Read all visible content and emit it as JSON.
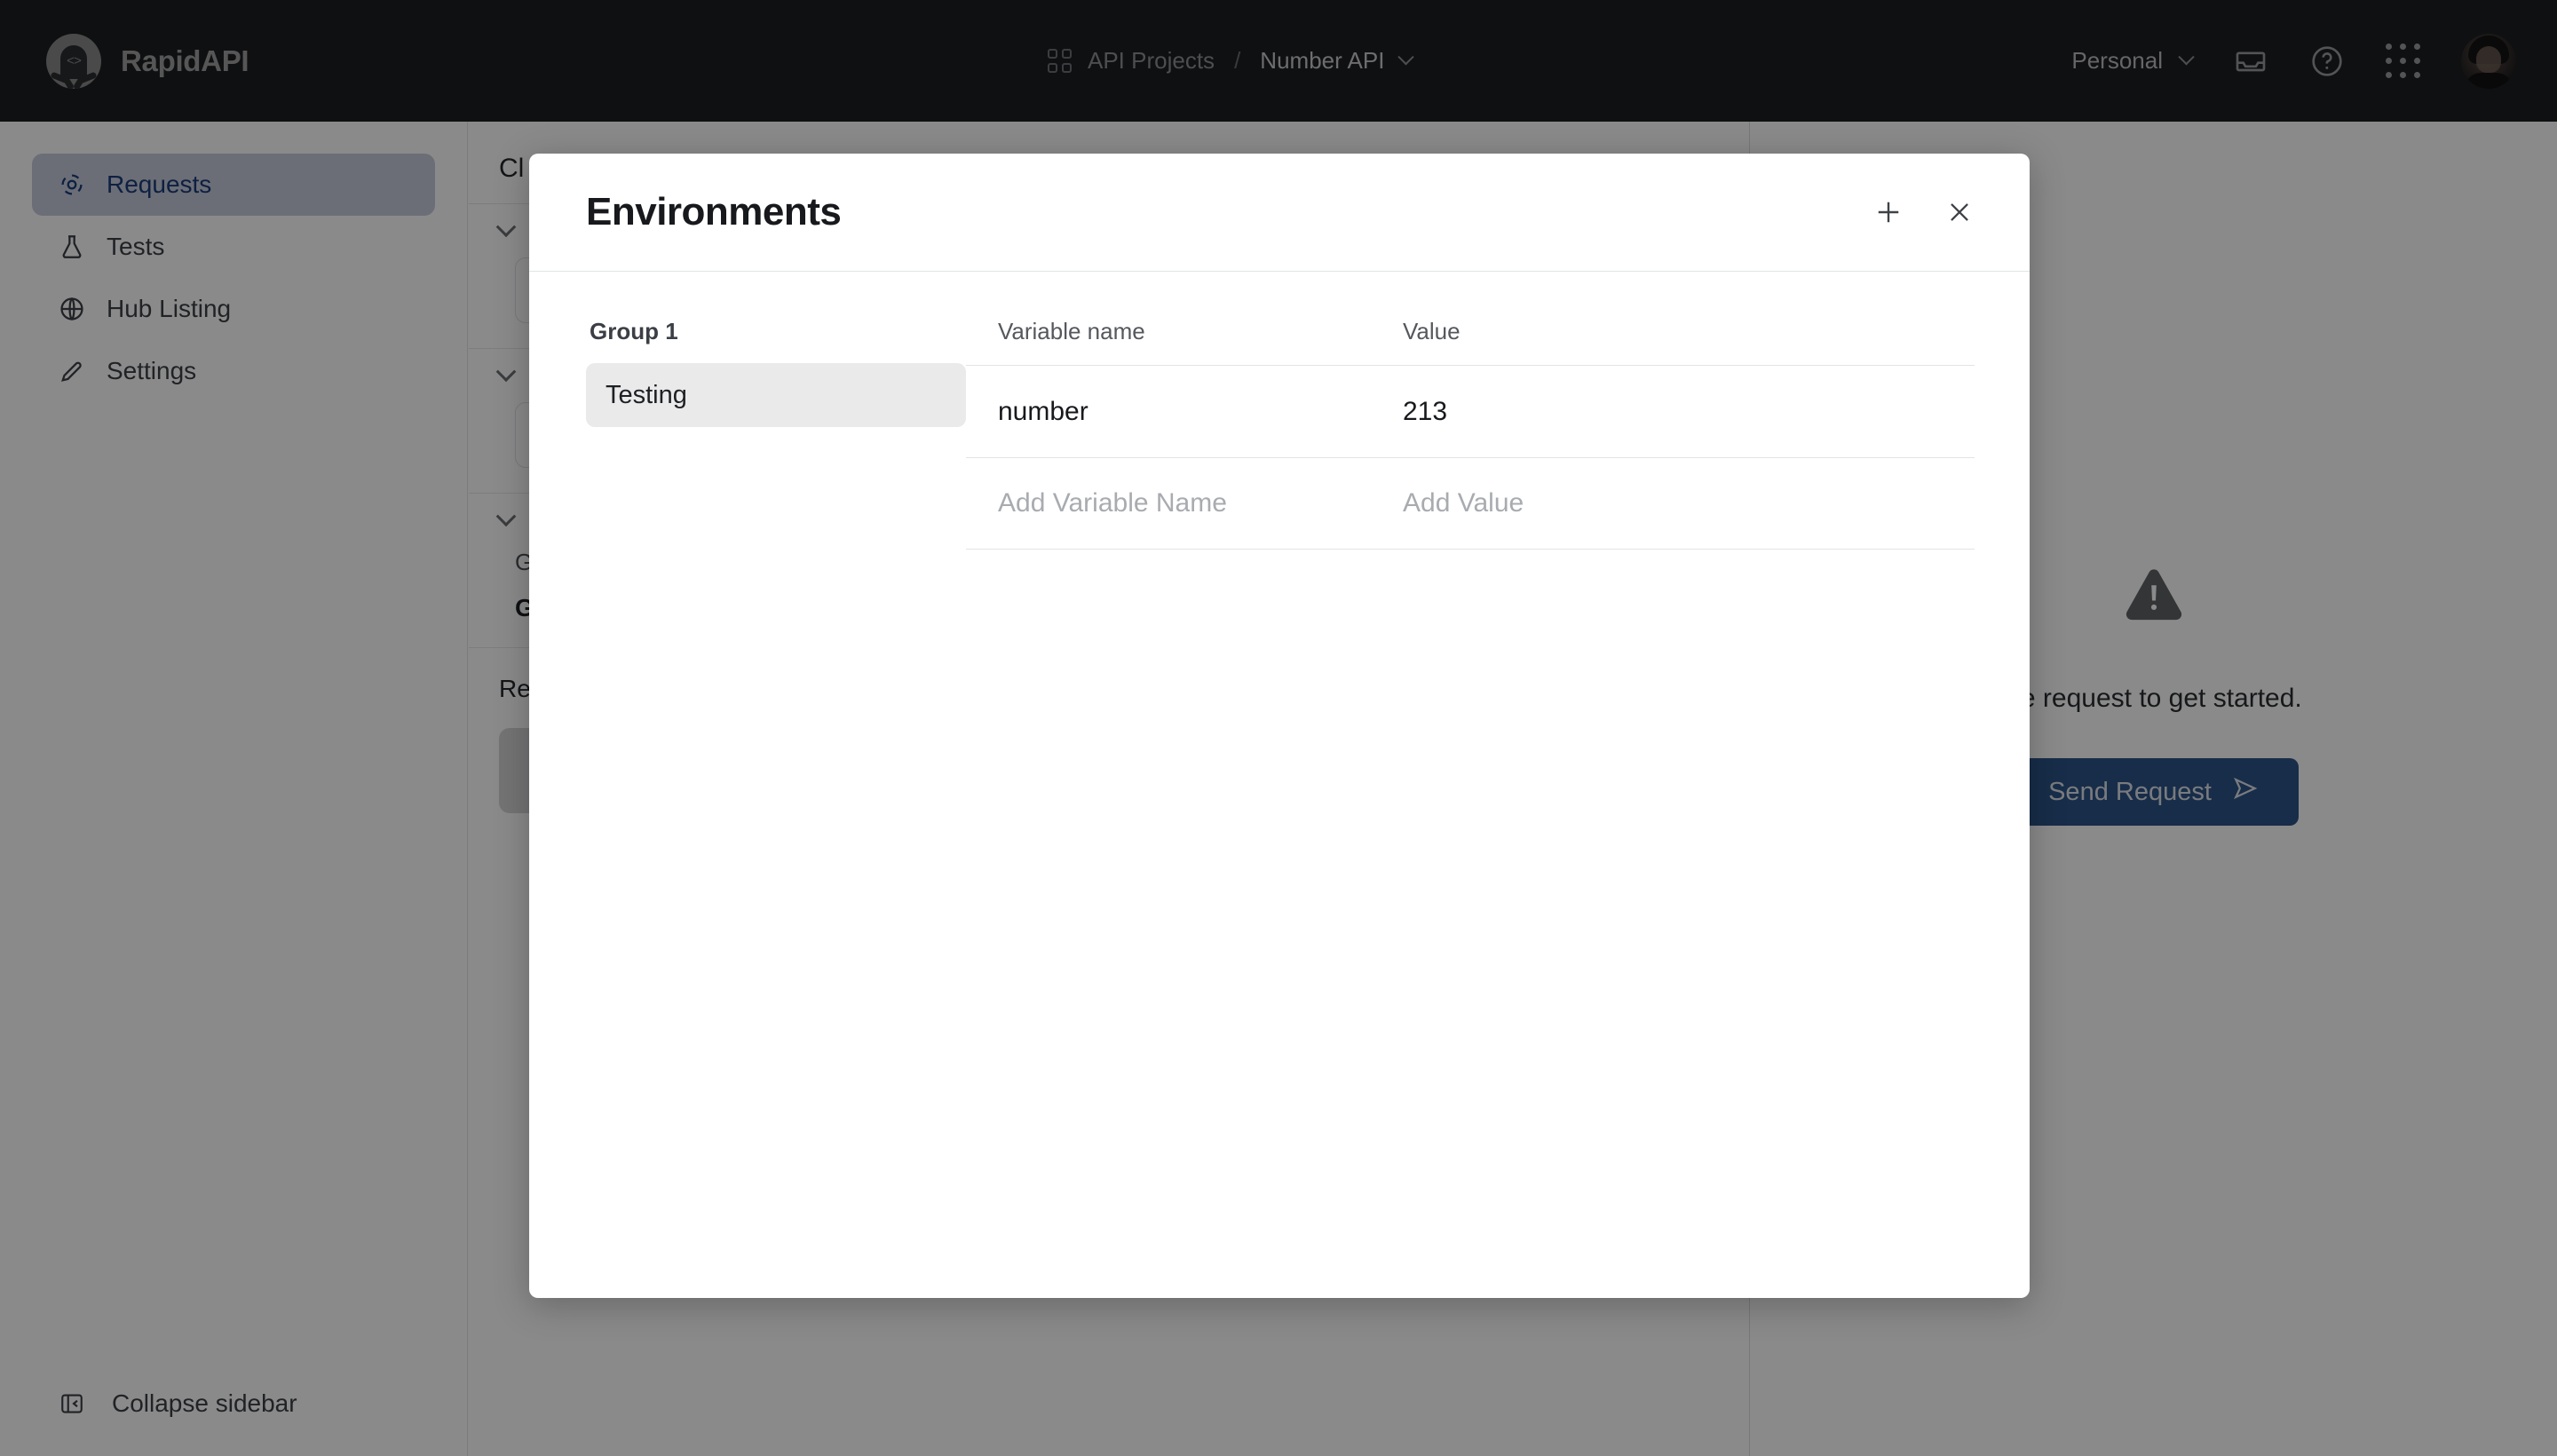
{
  "header": {
    "brand": "RapidAPI",
    "breadcrumb": {
      "root": "API Projects",
      "separator": "/",
      "current": "Number API"
    },
    "account": "Personal",
    "icons": {
      "apps_grid": "grid-icon",
      "inbox": "inbox-icon",
      "help": "help-circle-icon",
      "apps_dots": "apps-grid-dots-icon",
      "avatar": "user-avatar"
    }
  },
  "sidebar": {
    "items": [
      {
        "label": "Requests",
        "icon": "target-icon",
        "active": true
      },
      {
        "label": "Tests",
        "icon": "flask-icon",
        "active": false
      },
      {
        "label": "Hub Listing",
        "icon": "globe-icon",
        "active": false
      },
      {
        "label": "Settings",
        "icon": "pencil-icon",
        "active": false
      }
    ],
    "collapse_label": "Collapse sidebar",
    "collapse_icon": "collapse-panel-icon"
  },
  "background": {
    "collection_title": "Cl",
    "section_one_box": "",
    "section_two_box": "",
    "group_label": "G",
    "group_label_bold": "G",
    "response_title": "Re",
    "empty_state": {
      "text": "he request to get started.",
      "button": "Send Request",
      "button_icon": "send-icon",
      "warning_icon": "warning-triangle-icon"
    }
  },
  "modal": {
    "title": "Environments",
    "add_icon": "plus-icon",
    "close_icon": "close-icon",
    "group_label": "Group 1",
    "groups": [
      {
        "name": "Testing",
        "selected": true
      }
    ],
    "table": {
      "columns": [
        "Variable name",
        "Value"
      ],
      "rows": [
        {
          "name": "number",
          "value": "213"
        }
      ],
      "placeholder_row": {
        "name": "Add Variable Name",
        "value": "Add Value"
      }
    }
  },
  "colors": {
    "topbar_bg": "#1c1e21",
    "accent_blue": "#2c5387",
    "active_nav_bg": "#c6cbda",
    "active_nav_text": "#1b3b7a",
    "selected_group_bg": "#eaeaea"
  }
}
